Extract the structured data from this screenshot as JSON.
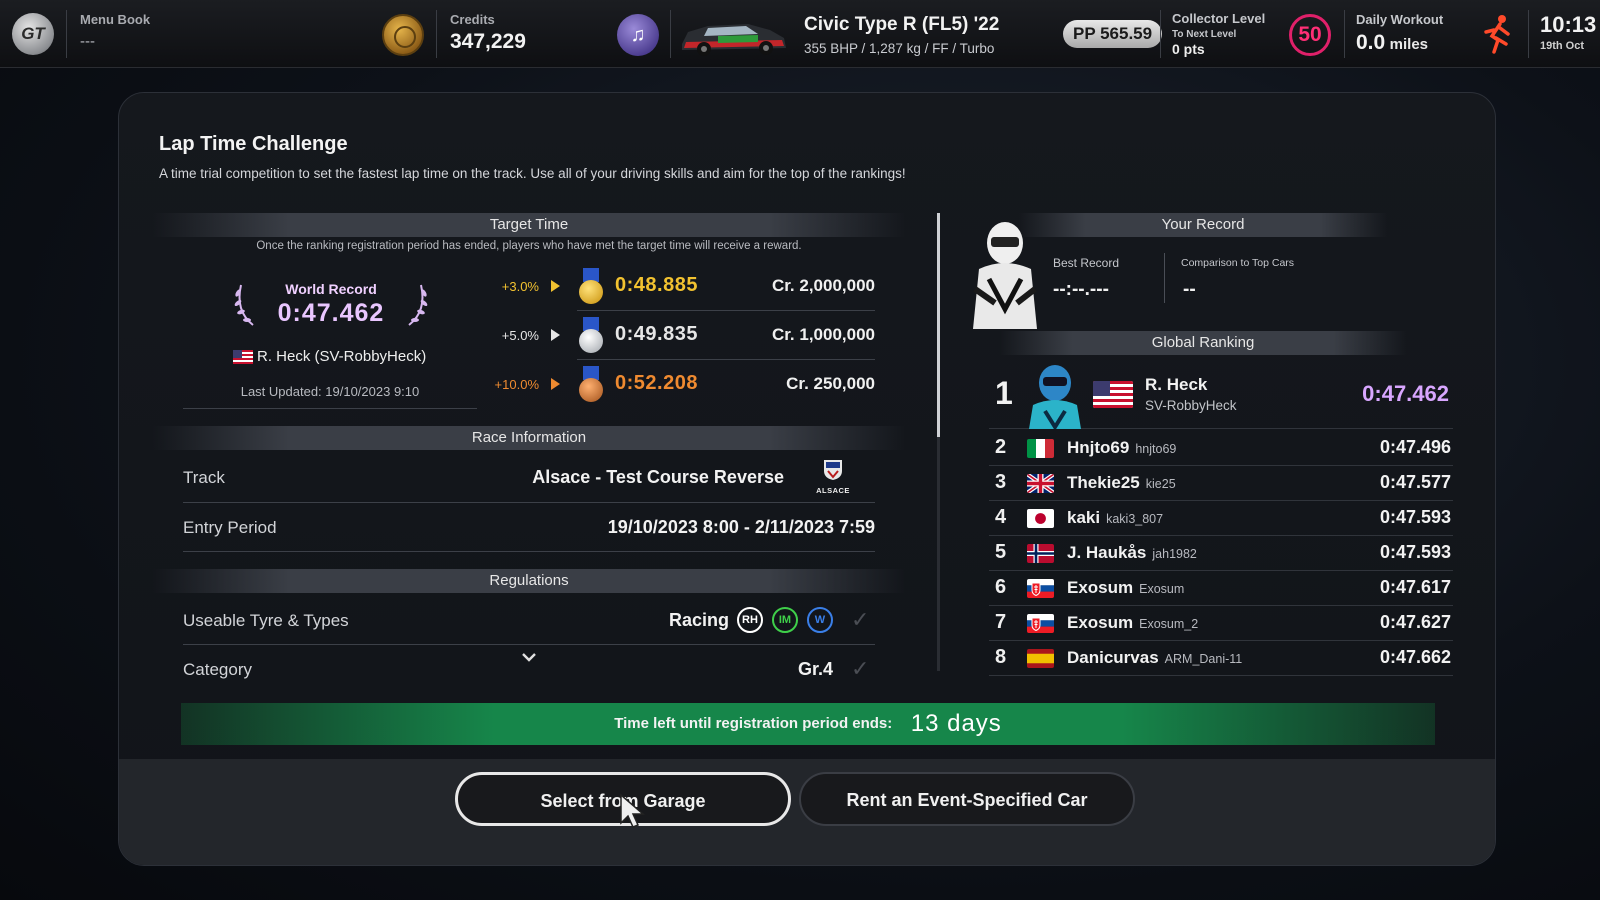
{
  "topbar": {
    "logo": "GT",
    "menu_book_label": "Menu Book",
    "menu_book_value": "---",
    "credits_label": "Credits",
    "credits_value": "347,229",
    "car_name": "Civic Type R (FL5) '22",
    "car_specs": "355 BHP / 1,287 kg / FF / Turbo",
    "pp": "PP 565.59",
    "collector_label": "Collector Level",
    "collector_sub": "To Next Level",
    "collector_pts": "0 pts",
    "collector_level": "50",
    "workout_label": "Daily Workout",
    "workout_value": "0.0",
    "workout_unit": "miles",
    "time": "10:13",
    "date": "19th Oct",
    "icons": [
      "gt-logo-icon",
      "credits-coin-icon",
      "music-icon",
      "car-thumbnail",
      "runner-icon"
    ]
  },
  "page": {
    "title": "Lap Time Challenge",
    "description": "A time trial competition to set the fastest lap time on the track. Use all of your driving skills and aim for the top of the rankings!"
  },
  "target_time": {
    "heading": "Target Time",
    "note": "Once the ranking registration period has ended, players who have met the target time will receive a reward.",
    "world_record_label": "World Record",
    "world_record_time": "0:47.462",
    "world_record_holder": "R. Heck (SV-RobbyHeck)",
    "last_updated": "Last Updated: 19/10/2023 9:10",
    "tiers": [
      {
        "pct": "+3.0%",
        "time": "0:48.885",
        "reward": "Cr.  2,000,000",
        "medal": "gold",
        "color": "#f2c230"
      },
      {
        "pct": "+5.0%",
        "time": "0:49.835",
        "reward": "Cr.  1,000,000",
        "medal": "silver",
        "color": "#e6e6e6"
      },
      {
        "pct": "+10.0%",
        "time": "0:52.208",
        "reward": "Cr.  250,000",
        "medal": "bronze",
        "color": "#ef8a30"
      }
    ]
  },
  "race_info": {
    "heading": "Race Information",
    "track_label": "Track",
    "track_value": "Alsace - Test Course Reverse",
    "track_logo_text": "ALSACE",
    "entry_label": "Entry Period",
    "entry_value": "19/10/2023 8:00 - 2/11/2023 7:59"
  },
  "regulations": {
    "heading": "Regulations",
    "tyre_label": "Useable Tyre & Types",
    "tyre_value": "Racing",
    "tyres": [
      {
        "code": "RH",
        "color": "#ffffff"
      },
      {
        "code": "IM",
        "color": "#3fcf4a"
      },
      {
        "code": "W",
        "color": "#3a7fe8"
      }
    ],
    "category_label": "Category",
    "category_value": "Gr.4"
  },
  "your_record": {
    "heading": "Your Record",
    "best_label": "Best Record",
    "best_value": "--:--.---",
    "compare_label": "Comparison to Top Cars",
    "compare_value": "--"
  },
  "ranking": {
    "heading": "Global Ranking",
    "top": {
      "pos": "1",
      "name": "R. Heck",
      "id": "SV-RobbyHeck",
      "time": "0:47.462",
      "flag": "us"
    },
    "rows": [
      {
        "pos": "2",
        "name": "Hnjto69",
        "id": "hnjto69",
        "time": "0:47.496",
        "flag": "it"
      },
      {
        "pos": "3",
        "name": "Thekie25",
        "id": "kie25",
        "time": "0:47.577",
        "flag": "gb"
      },
      {
        "pos": "4",
        "name": "kaki",
        "id": "kaki3_807",
        "time": "0:47.593",
        "flag": "jp"
      },
      {
        "pos": "5",
        "name": "J. Haukås",
        "id": "jah1982",
        "time": "0:47.593",
        "flag": "no"
      },
      {
        "pos": "6",
        "name": "Exosum",
        "id": "Exosum",
        "time": "0:47.617",
        "flag": "sk"
      },
      {
        "pos": "7",
        "name": "Exosum",
        "id": "Exosum_2",
        "time": "0:47.627",
        "flag": "sk"
      },
      {
        "pos": "8",
        "name": "Danicurvas",
        "id": "ARM_Dani-11",
        "time": "0:47.662",
        "flag": "es"
      }
    ]
  },
  "banner": {
    "label": "Time left until registration period ends:",
    "value": "13 days"
  },
  "buttons": {
    "garage": "Select from Garage",
    "rent": "Rent an Event-Specified Car"
  }
}
